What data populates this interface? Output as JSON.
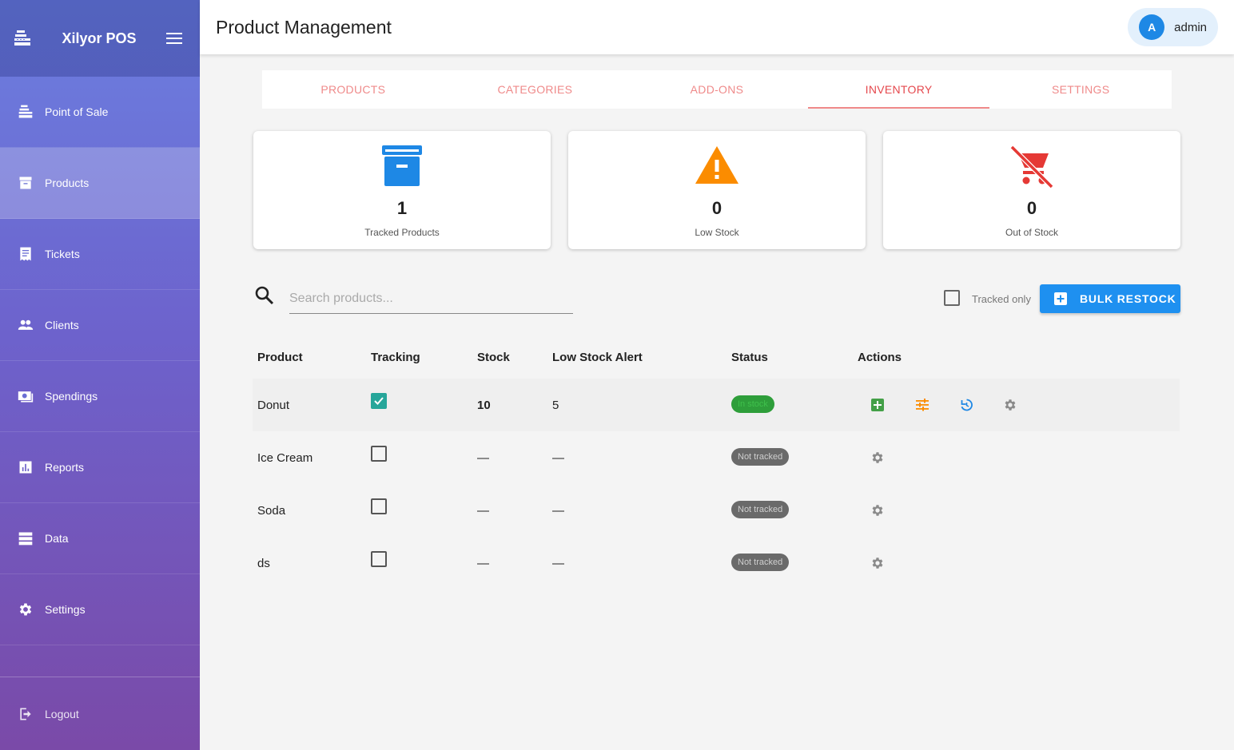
{
  "sidebar": {
    "brand": "Xilyor POS",
    "items": [
      {
        "label": "Point of Sale",
        "icon": "cash-register-icon"
      },
      {
        "label": "Products",
        "icon": "archive-box-icon",
        "active": true
      },
      {
        "label": "Tickets",
        "icon": "receipt-icon"
      },
      {
        "label": "Clients",
        "icon": "people-icon"
      },
      {
        "label": "Spendings",
        "icon": "money-icon"
      },
      {
        "label": "Reports",
        "icon": "bar-chart-icon"
      },
      {
        "label": "Data",
        "icon": "storage-icon"
      },
      {
        "label": "Settings",
        "icon": "gear-icon"
      }
    ],
    "logout": "Logout"
  },
  "header": {
    "title": "Product Management",
    "user": {
      "initial": "A",
      "name": "admin"
    }
  },
  "tabs": [
    {
      "label": "PRODUCTS"
    },
    {
      "label": "CATEGORIES"
    },
    {
      "label": "ADD-ONS"
    },
    {
      "label": "INVENTORY",
      "active": true
    },
    {
      "label": "SETTINGS"
    }
  ],
  "cards": [
    {
      "value": "1",
      "label": "Tracked Products",
      "icon": "archive-box-icon",
      "color": "#1e88e5"
    },
    {
      "value": "0",
      "label": "Low Stock",
      "icon": "warning-icon",
      "color": "#fb8c00"
    },
    {
      "value": "0",
      "label": "Out of Stock",
      "icon": "remove-cart-icon",
      "color": "#e53935"
    }
  ],
  "toolbar": {
    "search_placeholder": "Search products...",
    "tracked_only": "Tracked only",
    "bulk_restock": "BULK RESTOCK"
  },
  "table": {
    "headers": [
      "Product",
      "Tracking",
      "Stock",
      "Low Stock Alert",
      "Status",
      "Actions"
    ],
    "rows": [
      {
        "product": "Donut",
        "tracking": true,
        "stock": "10",
        "alert": "5",
        "status": "In stock"
      },
      {
        "product": "Ice Cream",
        "tracking": false,
        "stock": "—",
        "alert": "—",
        "status": "Not tracked"
      },
      {
        "product": "Soda",
        "tracking": false,
        "stock": "—",
        "alert": "—",
        "status": "Not tracked"
      },
      {
        "product": "ds",
        "tracking": false,
        "stock": "—",
        "alert": "—",
        "status": "Not tracked"
      }
    ]
  }
}
